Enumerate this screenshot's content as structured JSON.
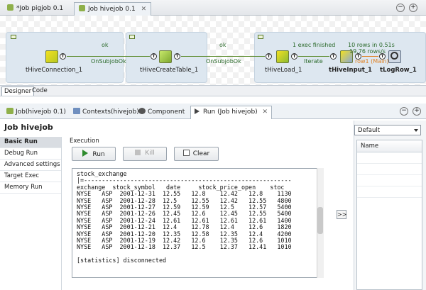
{
  "editor_tabs": [
    {
      "label": "*Job pigjob 0.1"
    },
    {
      "label": "Job hivejob 0.1"
    }
  ],
  "canvas": {
    "components": [
      {
        "label": "tHiveConnection_1"
      },
      {
        "label": "tHiveCreateTable_1"
      },
      {
        "label": "tHiveLoad_1"
      },
      {
        "label": "tHiveInput_1"
      },
      {
        "label": "tLogRow_1"
      }
    ],
    "links": [
      {
        "top": "ok",
        "bottom": "OnSubjobOk"
      },
      {
        "top": "ok",
        "bottom": "OnSubjobOk"
      },
      {
        "top": "1 exec finished",
        "bottom": "Iterate"
      }
    ],
    "row_link": {
      "rows": "10 rows in 0.51s",
      "rate": "19.76 rows/s",
      "label": "row1 (Main)"
    }
  },
  "view_tabs": [
    {
      "label": "Designer"
    },
    {
      "label": "Code"
    }
  ],
  "pane_tabs": [
    {
      "label": "Job(hivejob 0.1)"
    },
    {
      "label": "Contexts(hivejob)"
    },
    {
      "label": "Component"
    },
    {
      "label": "Run (Job hivejob)"
    }
  ],
  "pane_controls": {
    "minimize": "−",
    "maximize": "+"
  },
  "job": {
    "title": "Job hivejob"
  },
  "nav": [
    {
      "label": "Basic Run"
    },
    {
      "label": "Debug Run"
    },
    {
      "label": "Advanced settings"
    },
    {
      "label": "Target Exec"
    },
    {
      "label": "Memory Run"
    }
  ],
  "execution": {
    "label": "Execution",
    "run": "Run",
    "kill": "Kill",
    "clear": "Clear"
  },
  "console": {
    "text": "stock_exchange\n|=----------------------------------------------------------\nexchange  stock_symbol   date     stock_price_open    stoc\nNYSE   ASP  2001-12-31  12.55   12.8    12.42   12.8    1130\nNYSE   ASP  2001-12-28  12.5    12.55   12.42   12.55   4800\nNYSE   ASP  2001-12-27  12.59   12.59   12.5    12.57   5400\nNYSE   ASP  2001-12-26  12.45   12.6    12.45   12.55   5400\nNYSE   ASP  2001-12-24  12.61   12.61   12.61   12.61   1400\nNYSE   ASP  2001-12-21  12.4    12.78   12.4    12.6    1820\nNYSE   ASP  2001-12-20  12.35   12.58   12.35   12.4    4200\nNYSE   ASP  2001-12-19  12.42   12.6    12.35   12.6    1010\nNYSE   ASP  2001-12-18  12.37   12.5    12.37   12.41   1010\n\n[statistics] disconnected"
  },
  "right": {
    "select_value": "Default",
    "column_header": "Name",
    "move_button": ">>"
  },
  "colors": {
    "tab_active": "#eef2f6",
    "link_green": "#5a8a2a",
    "row_orange": "#e08020",
    "subjob_bg": "#dde7f0"
  }
}
